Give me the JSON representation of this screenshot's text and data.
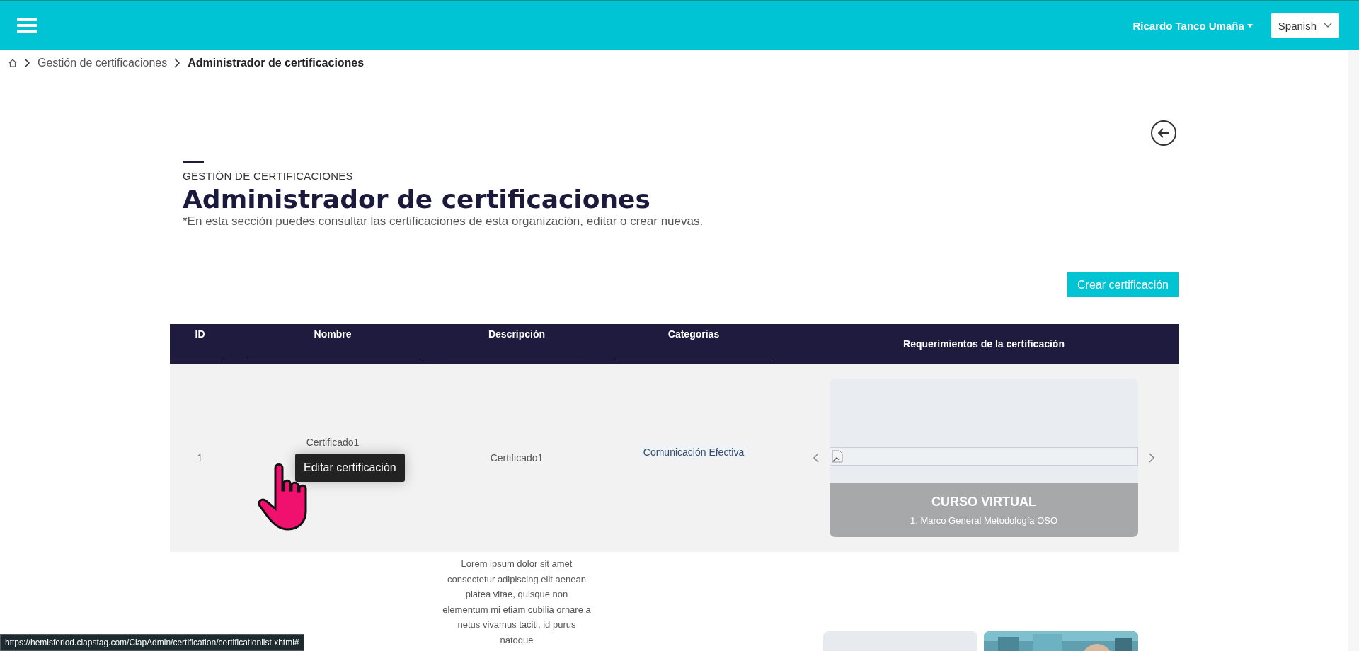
{
  "topbar": {
    "user": "Ricardo Tanco Umaña",
    "language": "Spanish"
  },
  "breadcrumb": [
    {
      "label": "Gestión de certificaciones",
      "current": false
    },
    {
      "label": "Administrador de certificaciones",
      "current": true
    }
  ],
  "header": {
    "eyebrow": "GESTIÓN DE CERTIFICACIONES",
    "title": "Administrador de certificaciones",
    "subtitle": "*En esta sección puedes consultar las certificaciones de esta organización, editar o crear nuevas."
  },
  "create_button": "Crear certificación",
  "table": {
    "columns": [
      {
        "label": "ID",
        "filter": true
      },
      {
        "label": "Nombre",
        "filter": true
      },
      {
        "label": "Descripción",
        "filter": true
      },
      {
        "label": "Categorias",
        "filter": true
      },
      {
        "label": "Requerimientos de la certificación",
        "filter": false
      }
    ],
    "rows": [
      {
        "id": "1",
        "name": "Certificado1",
        "description": "Certificado1",
        "category": "Comunicación Efectiva",
        "requirement": {
          "type": "CURSO VIRTUAL",
          "name": "1. Marco General Metodología OSO"
        }
      },
      {
        "description": "Lorem ipsum dolor sit amet consectetur adipiscing elit aenean platea vitae, quisque non elementum mi etiam cubilia ornare a netus vivamus taciti, id purus natoque",
        "cards": [
          {
            "kind": "plain"
          },
          {
            "kind": "picture"
          }
        ]
      }
    ]
  },
  "tooltip": "Editar certificación",
  "status_url": "https://hemisferiod.clapstag.com/ClapAdmin/certification/certificationlist.xhtml#"
}
